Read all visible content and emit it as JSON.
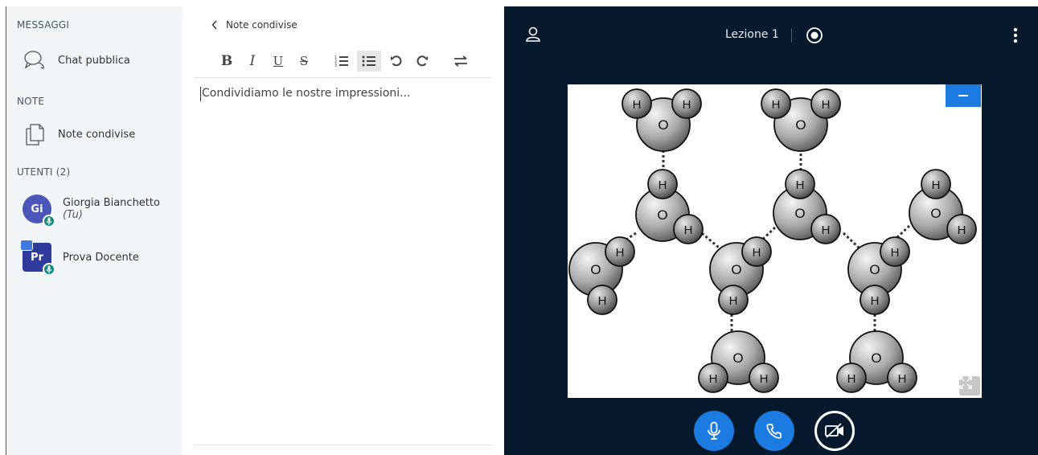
{
  "sidebar": {
    "messages_title": "MESSAGGI",
    "public_chat_label": "Chat pubblica",
    "notes_title": "NOTE",
    "shared_notes_label": "Note condivise",
    "users_title": "UTENTI (2)",
    "users": [
      {
        "initials": "Gi",
        "name": "Giorgia Bianchetto",
        "suffix": "(Tu)"
      },
      {
        "initials": "Pr",
        "name": "Prova Docente",
        "suffix": ""
      }
    ]
  },
  "notes": {
    "back_label": "Note condivise",
    "content": "Condividiamo le nostre impressioni...",
    "toolbar": {
      "bold": "B",
      "italic": "I",
      "underline": "U",
      "strike": "S"
    }
  },
  "presentation": {
    "title": "Lezione 1",
    "atom_labels": {
      "oxygen": "O",
      "hydrogen": "H"
    }
  },
  "colors": {
    "accent": "#1b7be0",
    "sidebar_bg": "#f3f6f9",
    "presentation_bg": "#07192c",
    "badge": "#0f8a7e"
  }
}
